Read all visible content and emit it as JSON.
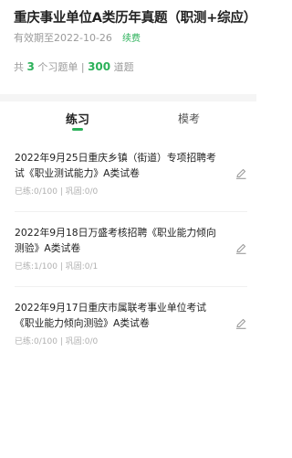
{
  "header": {
    "title": "重庆事业单位A类历年真题（职测+综应）",
    "validity": "有效期至2022-10-26",
    "renew_label": "续费",
    "stats_prefix": "共",
    "set_count": "3",
    "set_suffix": "个习题单 |",
    "question_count": "300",
    "question_suffix": "道题"
  },
  "tabs": [
    {
      "label": "练习",
      "active": true
    },
    {
      "label": "模考",
      "active": false
    }
  ],
  "items": [
    {
      "title": "2022年9月25日重庆乡镇（街道）专项招聘考试《职业测试能力》A类试卷",
      "progress": "已练:0/100 | 巩固:0/0"
    },
    {
      "title": "2022年9月18日万盛考核招聘《职业能力倾向测验》A类试卷",
      "progress": "已练:1/100 | 巩固:0/1"
    },
    {
      "title": "2022年9月17日重庆市属联考事业单位考试《职业能力倾向测验》A类试卷",
      "progress": "已练:0/100 | 巩固:0/0"
    }
  ],
  "colors": {
    "accent": "#2cb15a",
    "muted": "#9a9a9a",
    "band": "#f5f5f5"
  }
}
